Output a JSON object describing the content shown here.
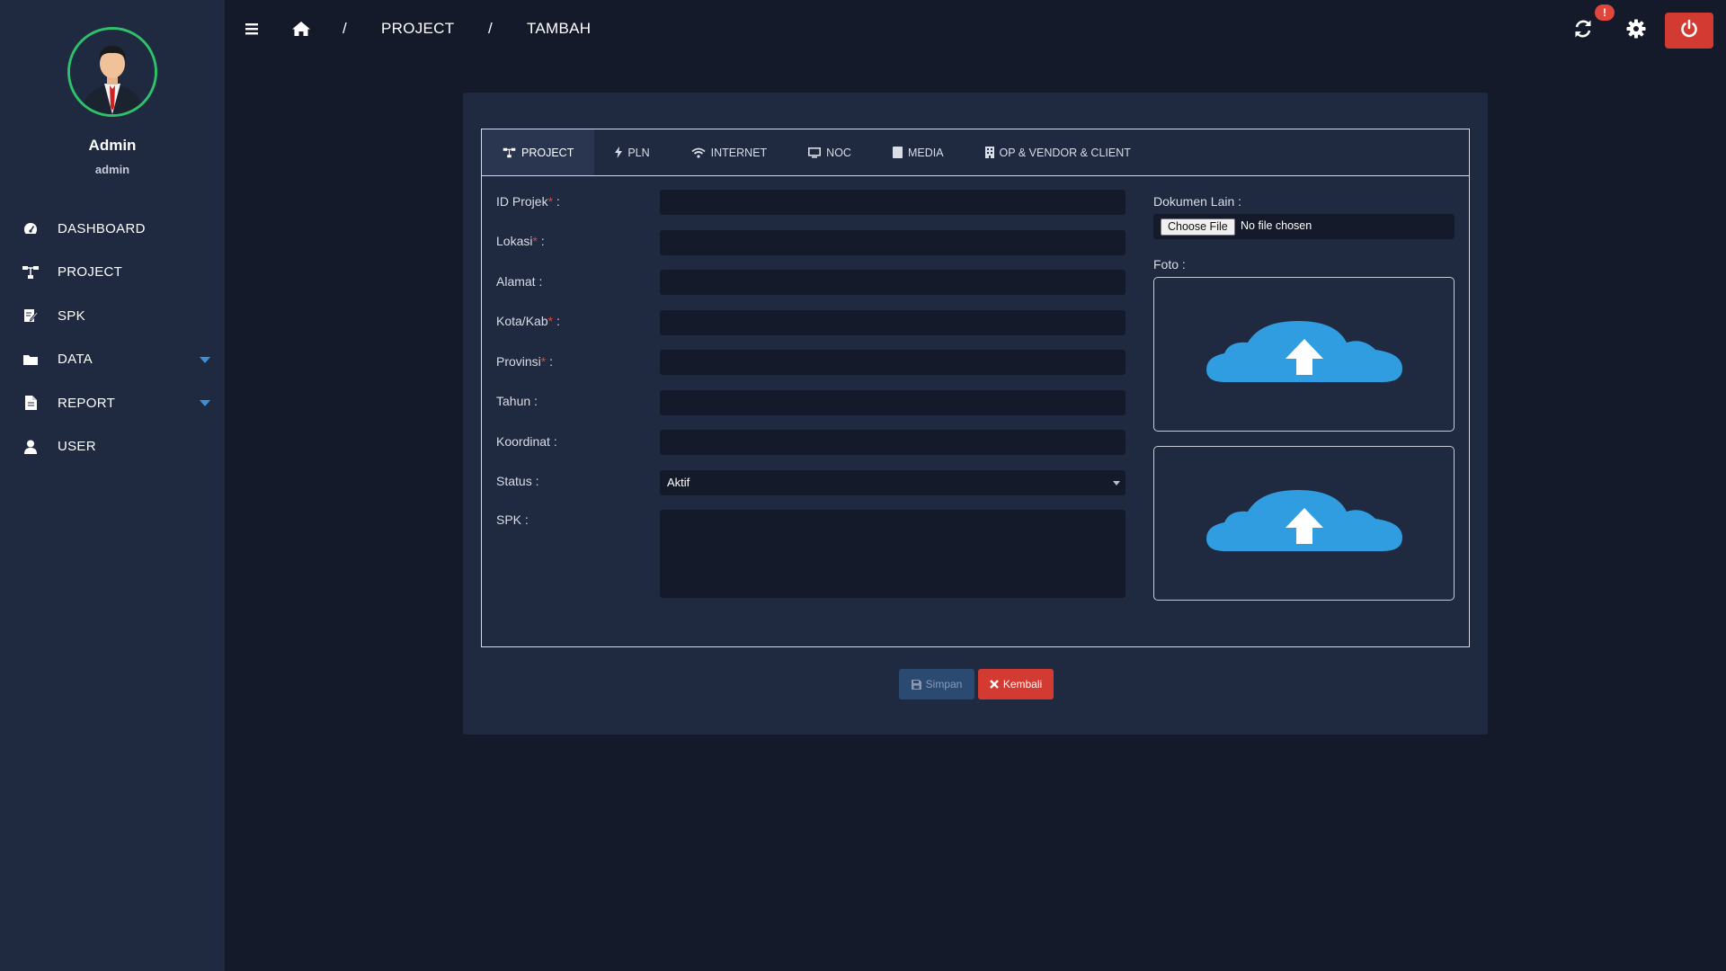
{
  "sidebar": {
    "user": {
      "name": "Admin",
      "role": "admin"
    },
    "items": [
      {
        "label": "DASHBOARD",
        "icon": "dashboard-icon"
      },
      {
        "label": "PROJECT",
        "icon": "sitemap-icon"
      },
      {
        "label": "SPK",
        "icon": "edit-document-icon"
      },
      {
        "label": "DATA",
        "icon": "folder-icon",
        "has_submenu": true
      },
      {
        "label": "REPORT",
        "icon": "file-icon",
        "has_submenu": true
      },
      {
        "label": "USER",
        "icon": "user-icon"
      }
    ]
  },
  "header": {
    "breadcrumb": {
      "sep": "/",
      "items": [
        "PROJECT",
        "TAMBAH"
      ]
    },
    "notification_badge": "!"
  },
  "tabs": [
    {
      "label": "PROJECT",
      "icon": "sitemap-icon",
      "active": true
    },
    {
      "label": "PLN",
      "icon": "bolt-icon"
    },
    {
      "label": "INTERNET",
      "icon": "wifi-icon"
    },
    {
      "label": "NOC",
      "icon": "monitor-icon"
    },
    {
      "label": "MEDIA",
      "icon": "media-icon"
    },
    {
      "label": "OP & VENDOR & CLIENT",
      "icon": "building-icon"
    }
  ],
  "form": {
    "required_mark": "*",
    "fields": [
      {
        "label": "ID Projek",
        "required": true,
        "value": ""
      },
      {
        "label": "Lokasi",
        "required": true,
        "value": ""
      },
      {
        "label": "Alamat",
        "required": false,
        "value": ""
      },
      {
        "label": "Kota/Kab",
        "required": true,
        "value": ""
      },
      {
        "label": "Provinsi",
        "required": true,
        "value": ""
      },
      {
        "label": "Tahun",
        "required": false,
        "value": ""
      },
      {
        "label": "Koordinat",
        "required": false,
        "value": ""
      }
    ],
    "status": {
      "label": "Status",
      "value": "Aktif"
    },
    "spk": {
      "label": "SPK",
      "value": ""
    },
    "dokumen": {
      "label": "Dokumen Lain",
      "button": "Choose File",
      "text": "No file chosen"
    },
    "foto": {
      "label": "Foto"
    }
  },
  "buttons": {
    "save": "Simpan",
    "back": "Kembali"
  },
  "colors": {
    "background": "#151a2b",
    "sidebar": "#1f2940",
    "danger": "#d33b32",
    "avatar_ring": "#2ec16a",
    "cloud": "#2f9de0"
  }
}
